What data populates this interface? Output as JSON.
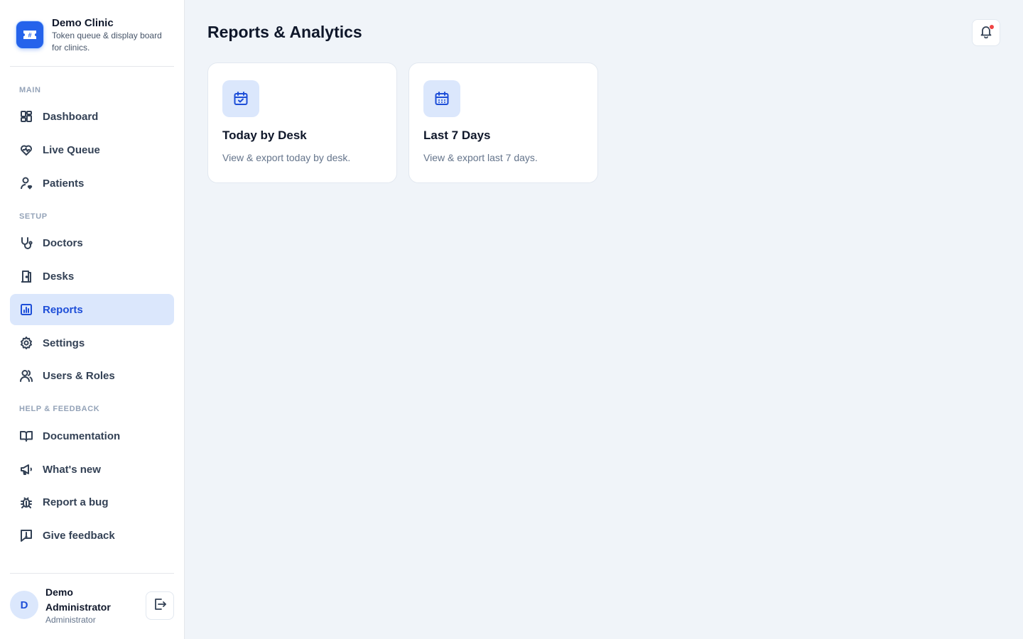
{
  "brand": {
    "name": "Demo Clinic",
    "tagline": "Token queue & display board for clinics.",
    "logo_icon": "ticket-icon"
  },
  "sidebar": {
    "sections": {
      "main": "MAIN",
      "setup": "SETUP",
      "help": "HELP & FEEDBACK"
    },
    "items": [
      {
        "label": "Dashboard",
        "icon": "dashboard-icon"
      },
      {
        "label": "Live Queue",
        "icon": "heart-pulse-icon"
      },
      {
        "label": "Patients",
        "icon": "user-heart-icon"
      },
      {
        "label": "Doctors",
        "icon": "stethoscope-icon"
      },
      {
        "label": "Desks",
        "icon": "door-icon"
      },
      {
        "label": "Reports",
        "icon": "bar-chart-icon",
        "active": true
      },
      {
        "label": "Settings",
        "icon": "gear-icon"
      },
      {
        "label": "Users & Roles",
        "icon": "users-icon"
      },
      {
        "label": "Documentation",
        "icon": "book-icon"
      },
      {
        "label": "What's new",
        "icon": "megaphone-icon"
      },
      {
        "label": "Report a bug",
        "icon": "bug-icon"
      },
      {
        "label": "Give feedback",
        "icon": "feedback-icon"
      }
    ]
  },
  "user": {
    "initial": "D",
    "name": "Demo Administrator",
    "role": "Administrator"
  },
  "main": {
    "title": "Reports & Analytics",
    "cards": [
      {
        "title": "Today by Desk",
        "description": "View & export today by desk.",
        "icon": "calendar-check-icon"
      },
      {
        "title": "Last 7 Days",
        "description": "View & export last 7 days.",
        "icon": "calendar-icon"
      }
    ]
  },
  "colors": {
    "accent": "#2563eb",
    "active_bg": "#dbe7fc",
    "notification_dot": "#ef4444"
  }
}
